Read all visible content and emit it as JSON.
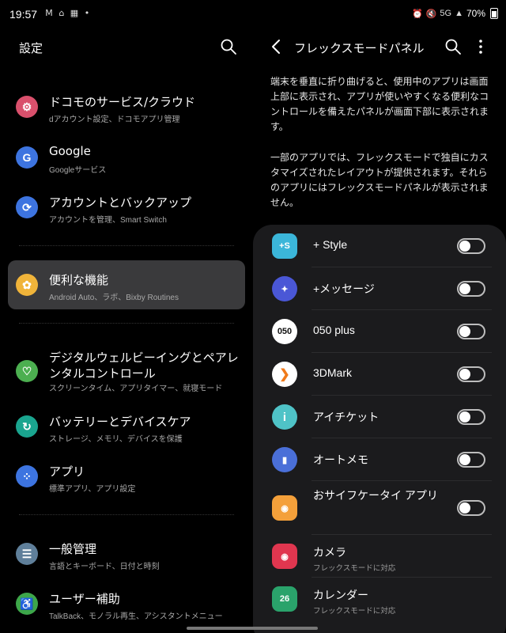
{
  "status_bar": {
    "time": "19:57",
    "left_icons": [
      "gmail-icon",
      "home-icon",
      "calendar-icon",
      "dot-icon"
    ],
    "right_icons": [
      "alarm-icon",
      "mute-icon",
      "5g-icon",
      "signal-icon"
    ],
    "network": "5G",
    "battery": "70%"
  },
  "left_panel": {
    "title": "設定",
    "items": [
      {
        "title": "ドコモのサービス/クラウド",
        "subtitle": "dアカウント設定、ドコモアプリ管理",
        "icon": "gear-icon",
        "color": "#d9506c"
      },
      {
        "title": "Google",
        "subtitle": "Googleサービス",
        "icon": "google-icon",
        "color": "#3d74e0"
      },
      {
        "title": "アカウントとバックアップ",
        "subtitle": "アカウントを管理、Smart Switch",
        "icon": "sync-icon",
        "color": "#3d74e0"
      },
      {
        "title": "便利な機能",
        "subtitle": "Android Auto、ラボ、Bixby Routines",
        "icon": "puzzle-icon",
        "color": "#f0b43a"
      },
      {
        "title": "デジタルウェルビーイングとペアレンタルコントロール",
        "subtitle": "スクリーンタイム、アプリタイマー、就寝モード",
        "icon": "wellbeing-icon",
        "color": "#4caf50"
      },
      {
        "title": "バッテリーとデバイスケア",
        "subtitle": "ストレージ、メモリ、デバイスを保護",
        "icon": "device-care-icon",
        "color": "#1aa58f"
      },
      {
        "title": "アプリ",
        "subtitle": "標準アプリ、アプリ設定",
        "icon": "apps-icon",
        "color": "#3d74e0"
      },
      {
        "title": "一般管理",
        "subtitle": "言語とキーボード、日付と時刻",
        "icon": "sliders-icon",
        "color": "#5f7f9a"
      },
      {
        "title": "ユーザー補助",
        "subtitle": "TalkBack、モノラル再生、アシスタントメニュー",
        "icon": "accessibility-icon",
        "color": "#3da64a"
      }
    ]
  },
  "right_panel": {
    "title": "フレックスモードパネル",
    "description_1": "端末を垂直に折り曲げると、使用中のアプリは画面上部に表示され、アプリが使いやすくなる便利なコントロールを備えたパネルが画面下部に表示されます。",
    "description_2": "一部のアプリでは、フレックスモードで独自にカスタマイズされたレイアウトが提供されます。それらのアプリにはフレックスモードパネルが表示されません。",
    "apps": [
      {
        "name": "+ Style",
        "toggle": false,
        "icon": "plus-style-icon",
        "icon_text": "+S",
        "bg": "#3bb6d9",
        "fg": "#ffffff"
      },
      {
        "name": "+メッセージ",
        "toggle": false,
        "icon": "plus-message-icon",
        "icon_text": "✦",
        "bg": "#4a57d6",
        "fg": "#ffffff"
      },
      {
        "name": "050 plus",
        "toggle": false,
        "icon": "050plus-icon",
        "icon_text": "050",
        "bg": "#ffffff",
        "fg": "#111111"
      },
      {
        "name": "3DMark",
        "toggle": false,
        "icon": "3dmark-icon",
        "icon_text": "❯",
        "bg": "#ffffff",
        "fg": "#f07a1a"
      },
      {
        "name": "アイチケット",
        "toggle": false,
        "icon": "iticket-icon",
        "icon_text": "i",
        "bg": "#4fc3c7",
        "fg": "#ffffff"
      },
      {
        "name": "オートメモ",
        "toggle": false,
        "icon": "automemo-icon",
        "icon_text": "▮",
        "bg": "#4a6fd8",
        "fg": "#ffffff"
      },
      {
        "name": "おサイフケータイ アプリ",
        "toggle": false,
        "icon": "osaifu-icon",
        "icon_text": "◉",
        "bg": "#f4a03a",
        "fg": "#ffffff"
      },
      {
        "name": "カメラ",
        "subtitle": "フレックスモードに対応",
        "icon": "camera-icon",
        "icon_text": "◉",
        "bg": "#e0364f",
        "fg": "#ffffff"
      },
      {
        "name": "カレンダー",
        "subtitle": "フレックスモードに対応",
        "icon": "calendar-app-icon",
        "icon_text": "26",
        "bg": "#2aa36b",
        "fg": "#ffffff"
      }
    ]
  }
}
